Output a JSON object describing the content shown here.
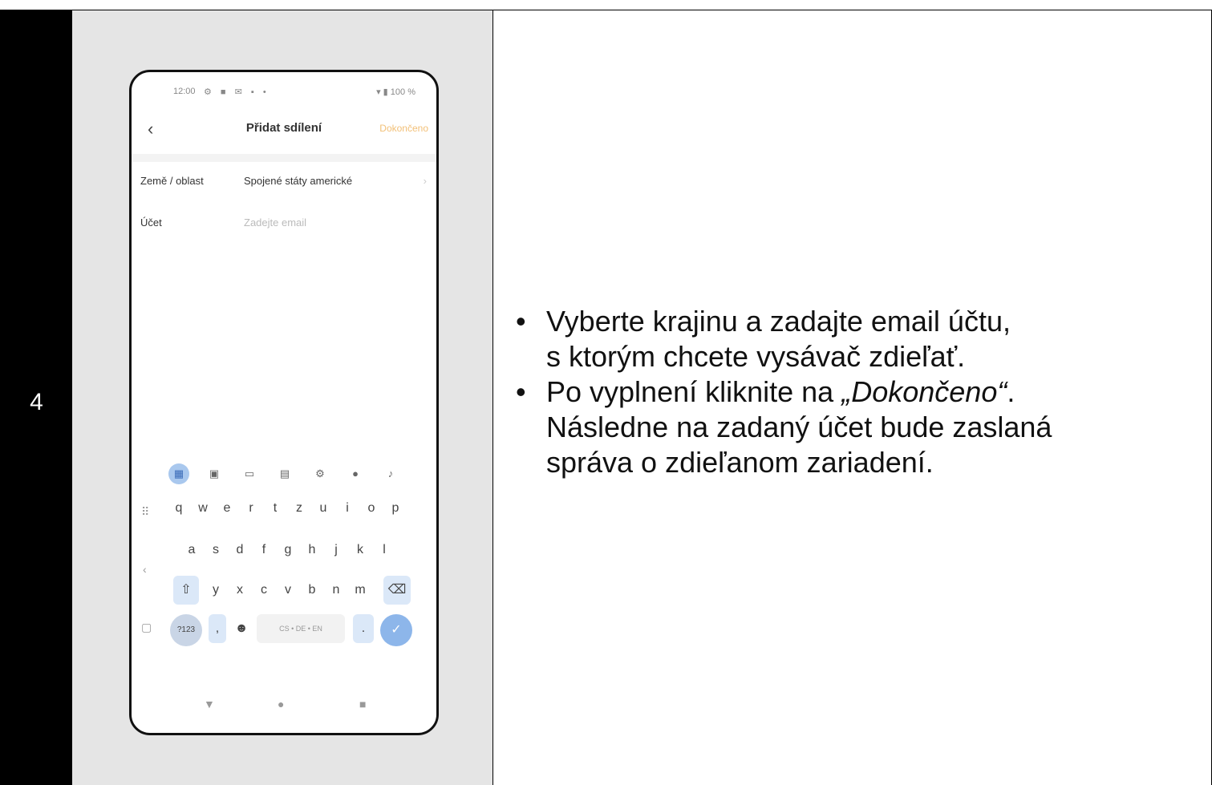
{
  "step": "4",
  "phone": {
    "status_time": "12:00",
    "status_right": "100 %",
    "title": "Přidat sdílení",
    "done_label": "Dokončeno",
    "rows": [
      {
        "label": "Země / oblast",
        "value": "Spojené státy americké"
      },
      {
        "label": "Účet",
        "placeholder": "Zadejte email"
      }
    ],
    "keyboard": {
      "row1": [
        "q",
        "w",
        "e",
        "r",
        "t",
        "z",
        "u",
        "i",
        "o",
        "p"
      ],
      "row2": [
        "a",
        "s",
        "d",
        "f",
        "g",
        "h",
        "j",
        "k",
        "l"
      ],
      "row3": [
        "y",
        "x",
        "c",
        "v",
        "b",
        "n",
        "m"
      ],
      "mode_key": "?123",
      "space_label": "CS • DE • EN",
      "period": "."
    }
  },
  "instructions": {
    "b1_line1": "Vyberte krajinu a zadajte email účtu,",
    "b1_line2": "s ktorým chcete vysávač zdieľať.",
    "b2_pre": "Po vyplnení kliknite na ",
    "b2_em": "„Dokončeno“",
    "b2_post": ".",
    "b2_line2": "Následne na zadaný účet bude zaslaná",
    "b2_line3": "správa o zdieľanom zariadení."
  },
  "icons": [
    "back-arrow-icon",
    "chevron-right-icon",
    "grid-icon",
    "sticker-icon",
    "gif-icon",
    "clipboard-icon",
    "settings-icon",
    "palette-icon",
    "microphone-icon",
    "shift-icon",
    "backspace-icon",
    "enter-check-icon",
    "emoji-icon",
    "nav-back-icon",
    "nav-home-icon",
    "nav-recents-icon"
  ]
}
